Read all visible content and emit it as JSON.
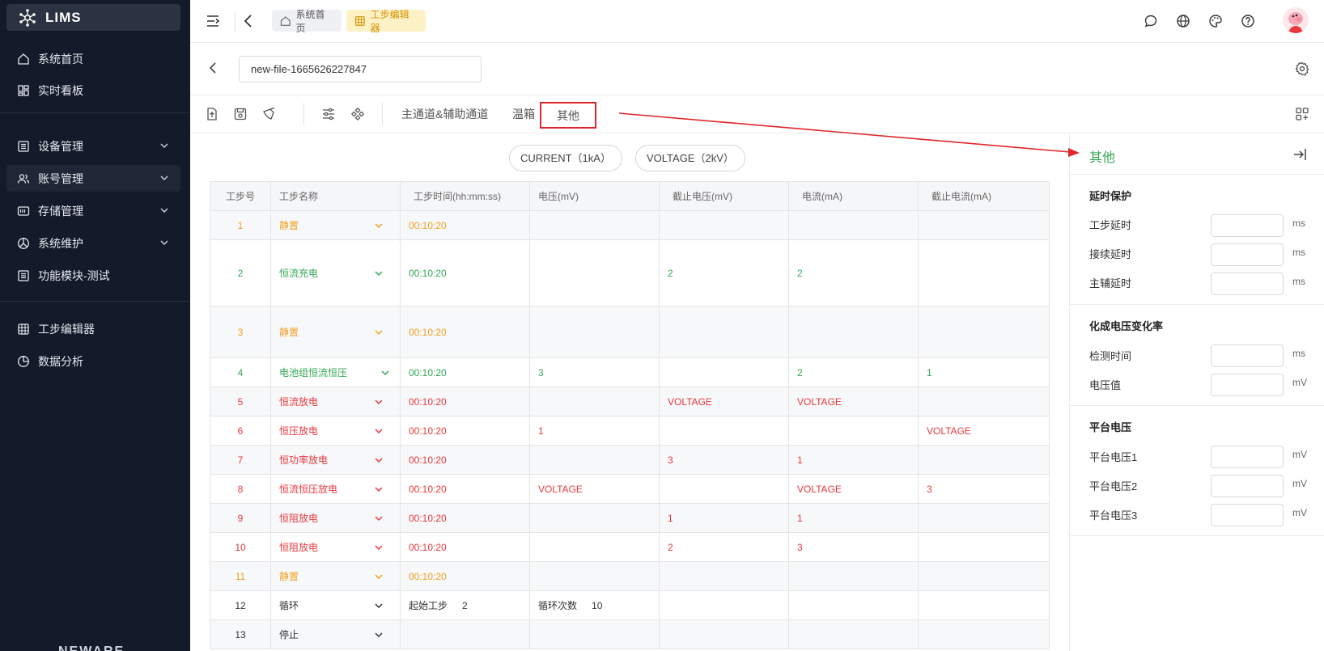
{
  "app": {
    "name": "LIMS"
  },
  "sidebar": {
    "items": [
      {
        "label": "系统首页",
        "icon": "home-icon"
      },
      {
        "label": "实时看板",
        "icon": "dashboard-icon"
      },
      {
        "label": "设备管理",
        "icon": "device-list-icon"
      },
      {
        "label": "账号管理",
        "icon": "users-icon"
      },
      {
        "label": "存储管理",
        "icon": "storage-icon"
      },
      {
        "label": "系统维护",
        "icon": "maintenance-icon"
      },
      {
        "label": "功能模块-测试",
        "icon": "module-icon"
      },
      {
        "label": "工步编辑器",
        "icon": "grid-table-icon"
      },
      {
        "label": "数据分析",
        "icon": "pie-chart-icon"
      }
    ],
    "footer": "NEWARE"
  },
  "header": {
    "breadcrumbs": [
      {
        "label": "系统首页"
      },
      {
        "label": "工步编辑器"
      }
    ]
  },
  "file": {
    "name": "new-file-1665626227847"
  },
  "toolbar": {
    "tabs": [
      {
        "label": "主通道&辅助通道"
      },
      {
        "label": "温箱"
      },
      {
        "label": "其他"
      }
    ]
  },
  "main": {
    "pills": [
      "CURRENT（1kA）",
      "VOLTAGE（2kV）"
    ],
    "columns": [
      "工步号",
      "工步名称",
      "工步时间(hh:mm:ss)",
      "电压(mV)",
      "截止电压(mV)",
      "电流(mA)",
      "截止电流(mA)"
    ],
    "rows": [
      {
        "no": "1",
        "name": "静置",
        "time": "00:10:20",
        "v": "",
        "cv": "",
        "i": "",
        "ci": "",
        "color": "orange"
      },
      {
        "no": "2",
        "name": "恒流充电",
        "time": "00:10:20",
        "v": "",
        "cv": "2",
        "i": "2",
        "ci": "",
        "color": "green"
      },
      {
        "no": "3",
        "name": "静置",
        "time": "00:10:20",
        "v": "",
        "cv": "",
        "i": "",
        "ci": "",
        "color": "orange"
      },
      {
        "no": "4",
        "name": "电池组恒流恒压",
        "time": "00:10:20",
        "v": "3",
        "cv": "",
        "i": "2",
        "ci": "1",
        "color": "green"
      },
      {
        "no": "5",
        "name": "恒流放电",
        "time": "00:10:20",
        "v": "",
        "cv": "VOLTAGE",
        "i": "VOLTAGE",
        "ci": "",
        "color": "red"
      },
      {
        "no": "6",
        "name": "恒压放电",
        "time": "00:10:20",
        "v": "1",
        "cv": "",
        "i": "",
        "ci": "VOLTAGE",
        "color": "red"
      },
      {
        "no": "7",
        "name": "恒功率放电",
        "time": "00:10:20",
        "v": "",
        "cv": "3",
        "i": "1",
        "ci": "",
        "color": "red"
      },
      {
        "no": "8",
        "name": "恒流恒压放电",
        "time": "00:10:20",
        "v": "VOLTAGE",
        "cv": "",
        "i": "VOLTAGE",
        "ci": "3",
        "color": "red"
      },
      {
        "no": "9",
        "name": "恒阻放电",
        "time": "00:10:20",
        "v": "",
        "cv": "1",
        "i": "1",
        "ci": "",
        "color": "red"
      },
      {
        "no": "10",
        "name": "恒阻放电",
        "time": "00:10:20",
        "v": "",
        "cv": "2",
        "i": "3",
        "ci": "",
        "color": "red"
      },
      {
        "no": "11",
        "name": "静置",
        "time": "00:10:20",
        "v": "",
        "cv": "",
        "i": "",
        "ci": "",
        "color": "orange"
      },
      {
        "no": "12",
        "name": "循环",
        "color": "black",
        "loop_start_label": "起始工步",
        "loop_start_value": "2",
        "loop_count_label": "循环次数",
        "loop_count_value": "10"
      },
      {
        "no": "13",
        "name": "停止",
        "color": "black"
      }
    ]
  },
  "panel": {
    "title": "其他",
    "sections": [
      {
        "title": "延时保护",
        "fields": [
          {
            "label": "工步延时",
            "unit": "ms"
          },
          {
            "label": "接续延时",
            "unit": "ms"
          },
          {
            "label": "主辅延时",
            "unit": "ms"
          }
        ]
      },
      {
        "title": "化成电压变化率",
        "fields": [
          {
            "label": "检测时间",
            "unit": "ms"
          },
          {
            "label": "电压值",
            "unit": "mV"
          }
        ]
      },
      {
        "title": "平台电压",
        "fields": [
          {
            "label": "平台电压1",
            "unit": "mV"
          },
          {
            "label": "平台电压2",
            "unit": "mV"
          },
          {
            "label": "平台电压3",
            "unit": "mV"
          }
        ]
      }
    ]
  },
  "colors": {
    "orange": "#f0a020",
    "green": "#34a853",
    "red": "#e8383d",
    "annotation": "#e0262a",
    "sidebar_bg": "#131a2a"
  }
}
